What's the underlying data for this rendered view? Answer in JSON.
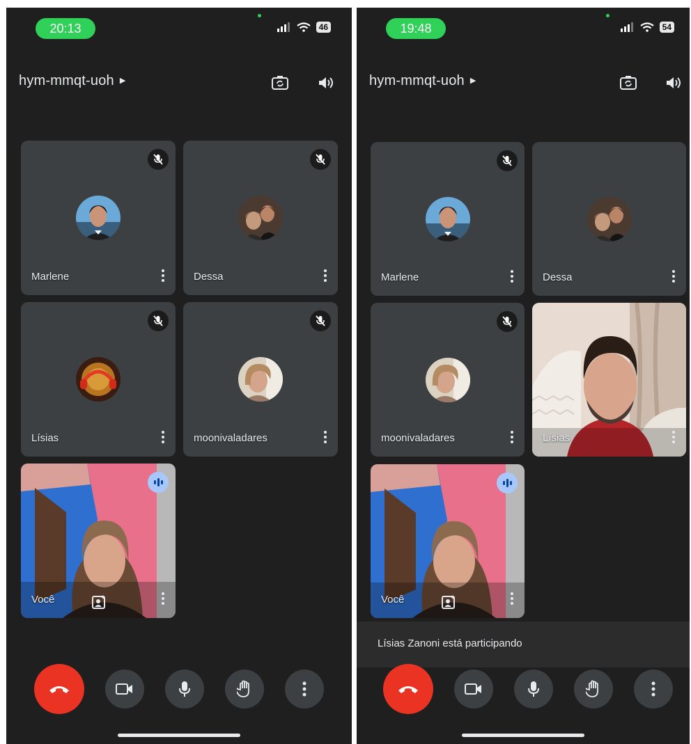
{
  "left": {
    "status": {
      "time": "20:13",
      "battery": "46"
    },
    "header": {
      "meeting_code": "hym-mmqt-uoh"
    },
    "tiles": [
      {
        "name": "Marlene",
        "muted": true
      },
      {
        "name": "Dessa",
        "muted": true
      },
      {
        "name": "Lísias",
        "muted": true
      },
      {
        "name": "moonivaladares",
        "muted": true
      },
      {
        "name": "Você",
        "speaking": true
      }
    ]
  },
  "right": {
    "status": {
      "time": "19:48",
      "battery": "54"
    },
    "header": {
      "meeting_code": "hym-mmqt-uoh"
    },
    "tiles": [
      {
        "name": "Marlene",
        "muted": true
      },
      {
        "name": "Dessa",
        "muted": false
      },
      {
        "name": "moonivaladares",
        "muted": true
      },
      {
        "name": "Lísias",
        "video": true
      },
      {
        "name": "Você",
        "speaking": true
      }
    ],
    "toast": "Lísias Zanoni está participando"
  },
  "colors": {
    "background": "#1f1f1f",
    "tile": "#3c4043",
    "end_call": "#ea3323",
    "status_pill": "#2fd158",
    "speaking_indicator": "#a8c7fa"
  },
  "icons": [
    "signal-icon",
    "wifi-icon",
    "battery-icon",
    "camera-switch-icon",
    "speaker-icon",
    "mic-off-icon",
    "more-vert-icon",
    "effects-icon",
    "end-call-icon",
    "camera-icon",
    "mic-icon",
    "raise-hand-icon",
    "more-options-icon"
  ]
}
